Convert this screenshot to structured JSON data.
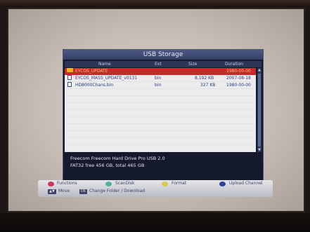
{
  "dialog": {
    "title": "USB Storage",
    "columns": {
      "name": "Name",
      "ext": "Ext",
      "size": "Size",
      "duration": "Duration"
    },
    "rows": [
      {
        "type": "folder",
        "name": "EYCOS_UPDATE",
        "ext": "",
        "size": "",
        "date": "1980-00-00",
        "selected": true
      },
      {
        "type": "file",
        "name": "EYCOS_MASS_UPDATE_v0131",
        "ext": "bin",
        "size": "8,192 KB",
        "date": "2007-08-18",
        "selected": false
      },
      {
        "type": "file",
        "name": "HD8000Chans.bin",
        "ext": "bin",
        "size": "327 KB",
        "date": "1980-00-00",
        "selected": false
      }
    ],
    "device": "Freecom Freecom Hard Drive Pro USB 2.0",
    "storage": "FAT32  free 456 GB, total 465 GB"
  },
  "legend": {
    "functions": "Functions",
    "scandisk": "ScanDisk",
    "format": "Format",
    "upload": "Upload Channel",
    "move_key": "▲▼",
    "move": "Move",
    "change_key": "OK",
    "change": "Change Folder / Download"
  },
  "colors": {
    "red": "#c8385e",
    "green": "#4fb0a0",
    "yellow": "#d9c64a",
    "blue": "#2f3f9c",
    "selection": "#c82a28"
  }
}
